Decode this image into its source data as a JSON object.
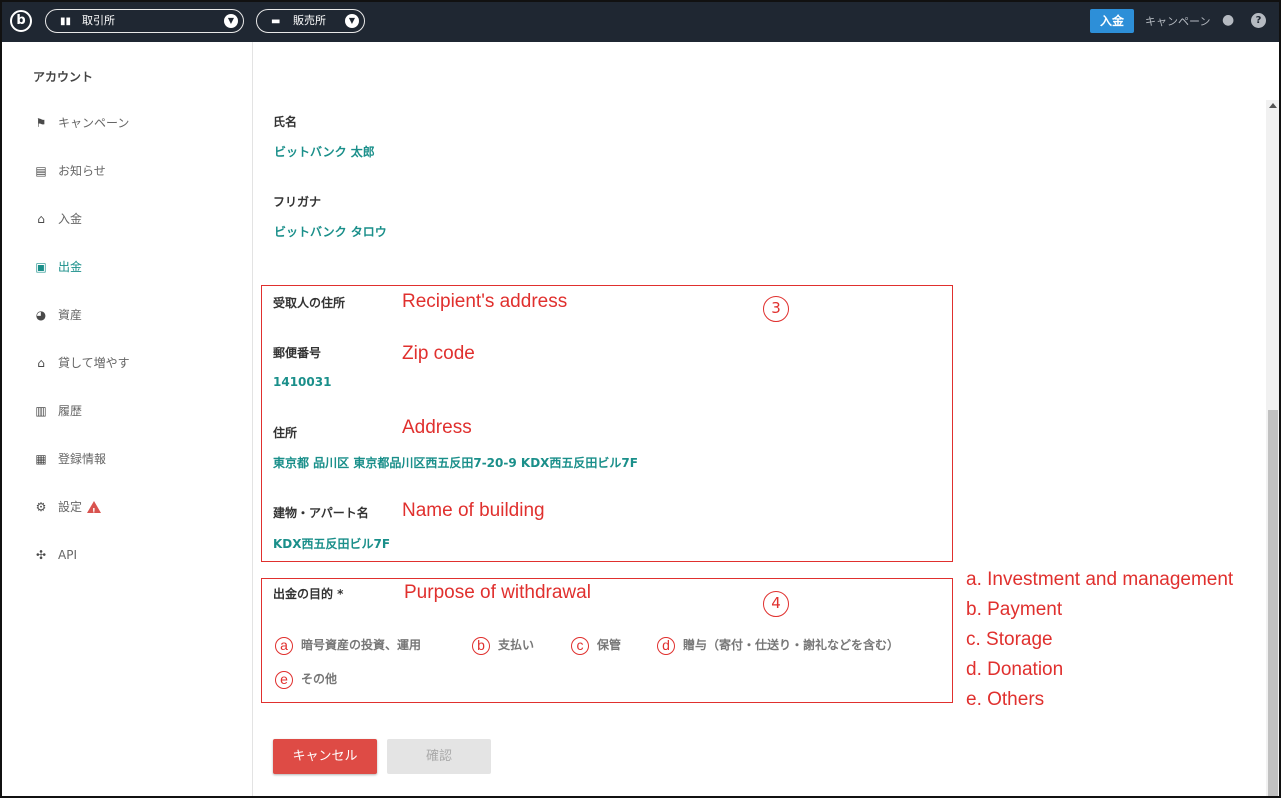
{
  "topbar": {
    "logo": "b",
    "exchange_label": "取引所",
    "exchange_icon": "bar-chart-icon",
    "store_label": "販売所",
    "store_icon": "store-icon",
    "deposit_label": "入金",
    "campaign_label": "キャンペーン",
    "help_glyph": "?"
  },
  "sidebar": {
    "title": "アカウント",
    "items": [
      {
        "label": "キャンペーン",
        "icon": "flag-icon",
        "glyph": "⚑"
      },
      {
        "label": "お知らせ",
        "icon": "message-icon",
        "glyph": "▤"
      },
      {
        "label": "入金",
        "icon": "bank-icon",
        "glyph": "⌂"
      },
      {
        "label": "出金",
        "icon": "wallet-icon",
        "glyph": "▣"
      },
      {
        "label": "資産",
        "icon": "pie-chart-icon",
        "glyph": "◕"
      },
      {
        "label": "貸して増やす",
        "icon": "bank-icon",
        "glyph": "⌂"
      },
      {
        "label": "履歴",
        "icon": "clipboard-icon",
        "glyph": "▥"
      },
      {
        "label": "登録情報",
        "icon": "id-badge-icon",
        "glyph": "▦"
      },
      {
        "label": "設定",
        "icon": "gear-icon",
        "glyph": "⚙"
      },
      {
        "label": "API",
        "icon": "api-icon",
        "glyph": "✣"
      }
    ],
    "active_index": 3
  },
  "form": {
    "name_label": "氏名",
    "name_value": "ビットバンク 太郎",
    "kana_label": "フリガナ",
    "kana_value": "ビットバンク タロウ",
    "address_section_label": "受取人の住所",
    "zip_label": "郵便番号",
    "zip_value": "1410031",
    "address_label": "住所",
    "address_value": "東京都 品川区 東京都品川区西五反田7-20-9 KDX西五反田ビル7F",
    "building_label": "建物・アパート名",
    "building_value": "KDX西五反田ビル7F",
    "purpose_label": "出金の目的 *",
    "purpose_options": [
      {
        "letter": "a",
        "label": "暗号資産の投資、運用"
      },
      {
        "letter": "b",
        "label": "支払い"
      },
      {
        "letter": "c",
        "label": "保管"
      },
      {
        "letter": "d",
        "label": "贈与（寄付・仕送り・謝礼などを含む）"
      },
      {
        "letter": "e",
        "label": "その他"
      }
    ],
    "cancel_label": "キャンセル",
    "confirm_label": "確認"
  },
  "annotations": {
    "recipient_address": "Recipient's address",
    "zip_code": "Zip code",
    "address": "Address",
    "building": "Name of building",
    "purpose": "Purpose of withdrawal",
    "marker_3": "③",
    "marker_4": "④",
    "legend": [
      "a. Investment and management",
      "b. Payment",
      "c. Storage",
      "d. Donation",
      "e. Others"
    ],
    "color": "#e0302e"
  },
  "colors": {
    "topbar_bg": "#1f2732",
    "accent_teal": "#1a8f8a",
    "deposit_blue": "#2d8fd8",
    "cancel_red": "#de4b45"
  }
}
